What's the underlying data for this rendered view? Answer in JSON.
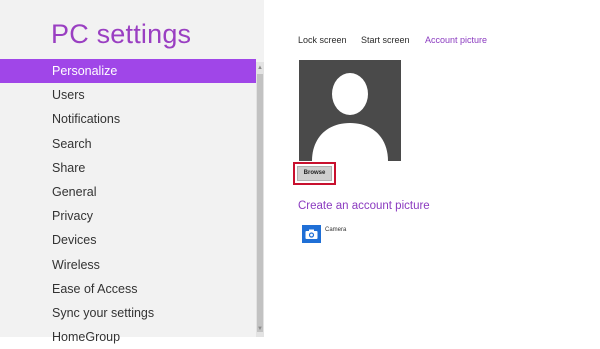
{
  "app": {
    "title": "PC settings"
  },
  "nav": {
    "items": [
      {
        "label": "Personalize"
      },
      {
        "label": "Users"
      },
      {
        "label": "Notifications"
      },
      {
        "label": "Search"
      },
      {
        "label": "Share"
      },
      {
        "label": "General"
      },
      {
        "label": "Privacy"
      },
      {
        "label": "Devices"
      },
      {
        "label": "Wireless"
      },
      {
        "label": "Ease of Access"
      },
      {
        "label": "Sync your settings"
      },
      {
        "label": "HomeGroup"
      }
    ],
    "selected_label": "Personalize"
  },
  "tabs": [
    {
      "label": "Lock screen"
    },
    {
      "label": "Start screen"
    },
    {
      "label": "Account picture"
    }
  ],
  "active_tab": "Account picture",
  "account_picture": {
    "browse_label": "Browse"
  },
  "create_section": {
    "heading": "Create an account picture",
    "apps": [
      {
        "label": "Camera",
        "icon": "camera-icon"
      }
    ]
  },
  "colors": {
    "accent": "#a046e8",
    "title": "#9a3fc2",
    "highlight_border": "#c8102e",
    "camera_tile": "#1f6fd6"
  }
}
